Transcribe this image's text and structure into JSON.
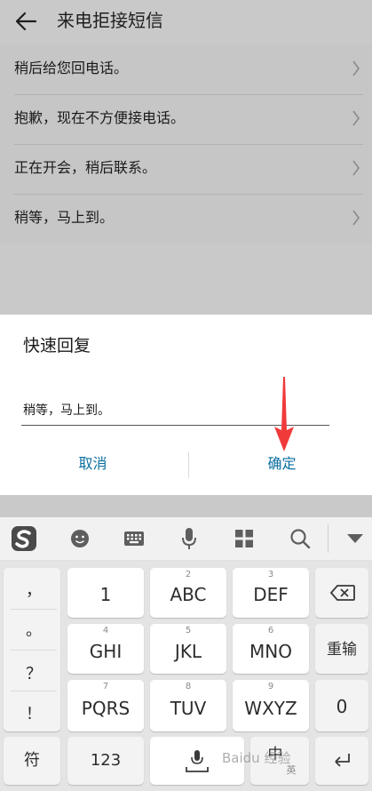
{
  "header": {
    "title": "来电拒接短信",
    "back_icon": "arrow-left-icon"
  },
  "messages": [
    {
      "text": "稍后给您回电话。"
    },
    {
      "text": "抱歉，现在不方便接电话。"
    },
    {
      "text": "正在开会，稍后联系。"
    },
    {
      "text": "稍等，马上到。"
    }
  ],
  "dialog": {
    "title": "快速回复",
    "input_value": "稍等，马上到。",
    "cancel_label": "取消",
    "confirm_label": "确定",
    "accent": "#0a6ea0"
  },
  "annotation": {
    "arrow_color": "#f03a3a"
  },
  "keyboard": {
    "toolbar_icons": [
      "sogou-logo-icon",
      "emoji-icon",
      "keyboard-icon",
      "microphone-icon",
      "grid-icon",
      "search-icon",
      "collapse-icon"
    ],
    "punctuation": [
      "，",
      "。",
      "？",
      "！"
    ],
    "keys": [
      {
        "num": "",
        "label": "1"
      },
      {
        "num": "2",
        "label": "ABC"
      },
      {
        "num": "3",
        "label": "DEF"
      },
      {
        "num": "4",
        "label": "GHI"
      },
      {
        "num": "5",
        "label": "JKL"
      },
      {
        "num": "6",
        "label": "MNO"
      },
      {
        "num": "7",
        "label": "PQRS"
      },
      {
        "num": "8",
        "label": "TUV"
      },
      {
        "num": "9",
        "label": "WXYZ"
      }
    ],
    "reinput_label": "重输",
    "zero_label": "0",
    "symbol_label": "符",
    "num123_label": "123",
    "lang_label": "中",
    "lang_sub": "英"
  },
  "watermark": "Baidu 经验"
}
